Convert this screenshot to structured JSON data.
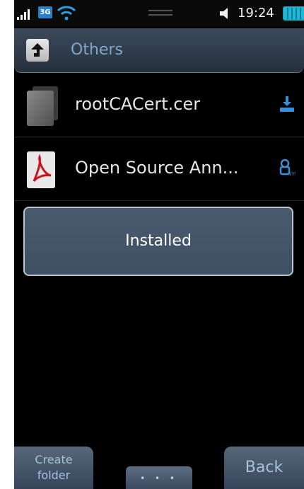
{
  "status_bar": {
    "network_badge": "3G",
    "time": "19:24",
    "icons": [
      "signal-icon",
      "wifi-icon",
      "volume-icon",
      "battery-icon"
    ],
    "battery_color": "#20b8d8"
  },
  "header": {
    "title": "Others",
    "back_icon": "up-arrow-icon",
    "title_color": "#7fa7cc"
  },
  "files": [
    {
      "name": "rootCACert.cer",
      "icon": "certificate-file-icon",
      "status_icon": "install-download-icon"
    },
    {
      "name": "Open Source Ann...",
      "icon": "pdf-file-icon",
      "status_icon": "system-file-icon"
    }
  ],
  "toast": {
    "message": "Installed"
  },
  "bottom_bar": {
    "create_folder_label": "Create\nfolder",
    "more_label": "• • •",
    "back_label": "Back"
  }
}
